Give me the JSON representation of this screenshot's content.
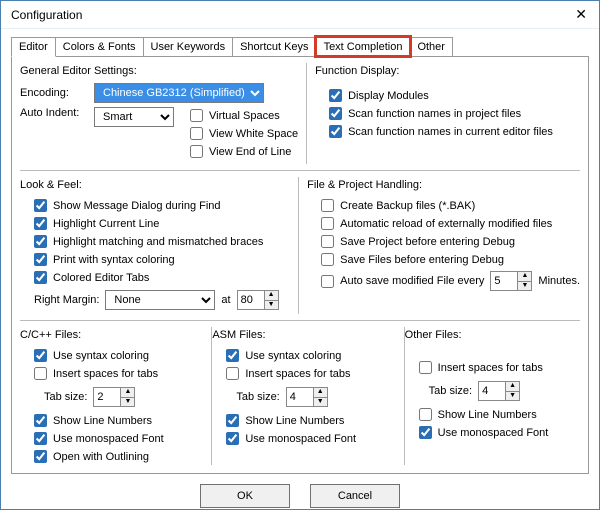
{
  "window": {
    "title": "Configuration",
    "close": "✕"
  },
  "tabs": {
    "editor": "Editor",
    "colors": "Colors & Fonts",
    "userkw": "User Keywords",
    "shortcut": "Shortcut Keys",
    "textcomp": "Text Completion",
    "other": "Other"
  },
  "general": {
    "title": "General Editor Settings:",
    "encoding_label": "Encoding:",
    "encoding_value": "Chinese GB2312 (Simplified)",
    "autoindent_label": "Auto Indent:",
    "autoindent_value": "Smart",
    "virtual_spaces": "Virtual Spaces",
    "view_white": "View White Space",
    "view_eol": "View End of Line"
  },
  "func": {
    "title": "Function Display:",
    "display_modules": "Display Modules",
    "scan_project": "Scan function names in project files",
    "scan_editor": "Scan function names in current editor files"
  },
  "look": {
    "title": "Look & Feel:",
    "showmsg": "Show Message Dialog during Find",
    "hlcurrent": "Highlight Current Line",
    "hlmatch": "Highlight matching and mismatched braces",
    "printsyntax": "Print with syntax coloring",
    "colortabs": "Colored Editor Tabs",
    "rmargin_label": "Right Margin:",
    "rmargin_value": "None",
    "at_label": "at",
    "at_value": "80"
  },
  "fph": {
    "title": "File & Project Handling:",
    "backup": "Create Backup files (*.BAK)",
    "reload": "Automatic reload of externally modified files",
    "saveproj": "Save Project before entering Debug",
    "savefiles": "Save Files before entering Debug",
    "autosave": "Auto save modified File every",
    "autosave_val": "5",
    "minutes": "Minutes."
  },
  "cc": {
    "title": "C/C++ Files:",
    "syntax": "Use syntax coloring",
    "spaces": "Insert spaces for tabs",
    "tabsize_label": "Tab size:",
    "tabsize": "2",
    "linenum": "Show Line Numbers",
    "mono": "Use monospaced Font",
    "outline": "Open with Outlining"
  },
  "asm": {
    "title": "ASM Files:",
    "syntax": "Use syntax coloring",
    "spaces": "Insert spaces for tabs",
    "tabsize_label": "Tab size:",
    "tabsize": "4",
    "linenum": "Show Line Numbers",
    "mono": "Use monospaced Font"
  },
  "other": {
    "title": "Other Files:",
    "spaces": "Insert spaces for tabs",
    "tabsize_label": "Tab size:",
    "tabsize": "4",
    "linenum": "Show Line Numbers",
    "mono": "Use monospaced Font"
  },
  "buttons": {
    "ok": "OK",
    "cancel": "Cancel"
  }
}
